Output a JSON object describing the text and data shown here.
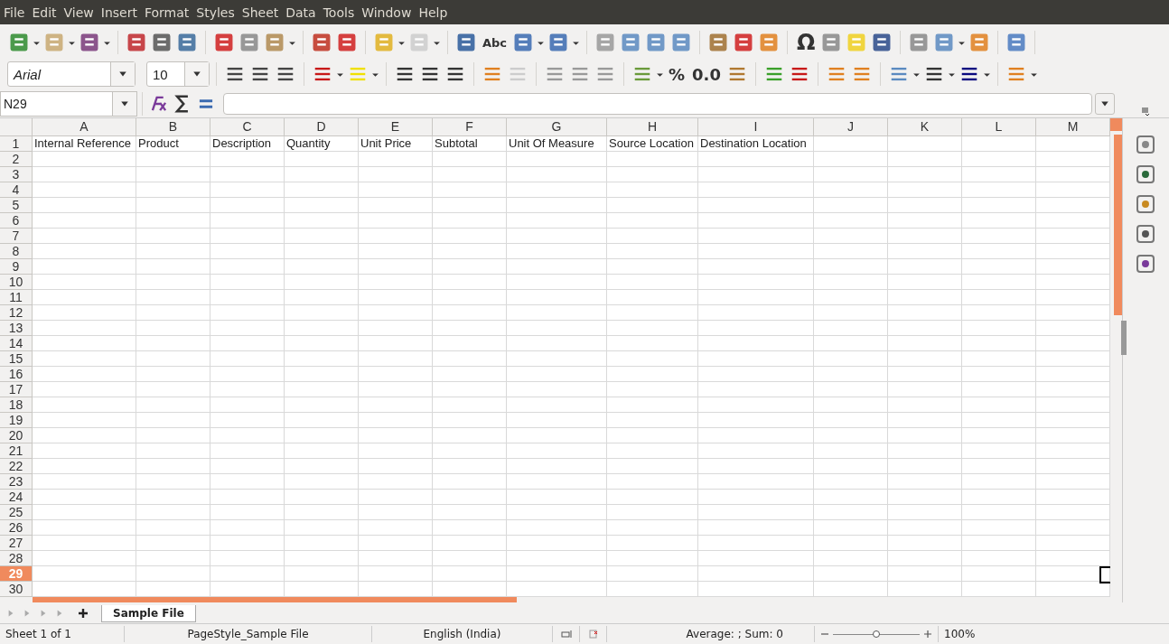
{
  "menu": [
    "File",
    "Edit",
    "View",
    "Insert",
    "Format",
    "Styles",
    "Sheet",
    "Data",
    "Tools",
    "Window",
    "Help"
  ],
  "toolbar_glyphs": {
    "spelling": "Abc",
    "special_character": "Ω",
    "percent": "%",
    "decimal": "0.0"
  },
  "font_name": {
    "value": "Arial"
  },
  "font_size": {
    "value": "10"
  },
  "name_box": {
    "value": "N29"
  },
  "columns": [
    {
      "label": "A",
      "selected": false
    },
    {
      "label": "B",
      "selected": false
    },
    {
      "label": "C",
      "selected": false
    },
    {
      "label": "D",
      "selected": false
    },
    {
      "label": "E",
      "selected": false
    },
    {
      "label": "F",
      "selected": false
    },
    {
      "label": "G",
      "selected": false
    },
    {
      "label": "H",
      "selected": false
    },
    {
      "label": "I",
      "selected": false
    },
    {
      "label": "J",
      "selected": false
    },
    {
      "label": "K",
      "selected": false
    },
    {
      "label": "L",
      "selected": false
    },
    {
      "label": "M",
      "selected": false
    }
  ],
  "rows": [
    {
      "label": "1",
      "selected": false,
      "cells": [
        "Internal Reference",
        "Product",
        "Description",
        "Quantity",
        "Unit Price",
        "Subtotal",
        "Unit Of Measure",
        "Source Location",
        "Destination Location"
      ]
    },
    {
      "label": "2",
      "selected": false
    },
    {
      "label": "3",
      "selected": false
    },
    {
      "label": "4",
      "selected": false
    },
    {
      "label": "5",
      "selected": false
    },
    {
      "label": "6",
      "selected": false
    },
    {
      "label": "7",
      "selected": false
    },
    {
      "label": "8",
      "selected": false
    },
    {
      "label": "9",
      "selected": false
    },
    {
      "label": "10",
      "selected": false
    },
    {
      "label": "11",
      "selected": false
    },
    {
      "label": "12",
      "selected": false
    },
    {
      "label": "13",
      "selected": false
    },
    {
      "label": "14",
      "selected": false
    },
    {
      "label": "15",
      "selected": false
    },
    {
      "label": "16",
      "selected": false
    },
    {
      "label": "17",
      "selected": false
    },
    {
      "label": "18",
      "selected": false
    },
    {
      "label": "19",
      "selected": false
    },
    {
      "label": "20",
      "selected": false
    },
    {
      "label": "21",
      "selected": false
    },
    {
      "label": "22",
      "selected": false
    },
    {
      "label": "23",
      "selected": false
    },
    {
      "label": "24",
      "selected": false
    },
    {
      "label": "25",
      "selected": false
    },
    {
      "label": "26",
      "selected": false
    },
    {
      "label": "27",
      "selected": false
    },
    {
      "label": "28",
      "selected": false
    },
    {
      "label": "29",
      "selected": true
    },
    {
      "label": "30",
      "selected": false
    }
  ],
  "sheet_tabs": [
    {
      "label": "Sample File",
      "selected": true
    }
  ],
  "status_bar": {
    "sheet": "Sheet 1 of 1",
    "page_style": "PageStyle_Sample File",
    "language": "English (India)",
    "summary": "Average: ; Sum: 0",
    "zoom_slider": {
      "level": 0.5
    },
    "zoom": "100%"
  }
}
